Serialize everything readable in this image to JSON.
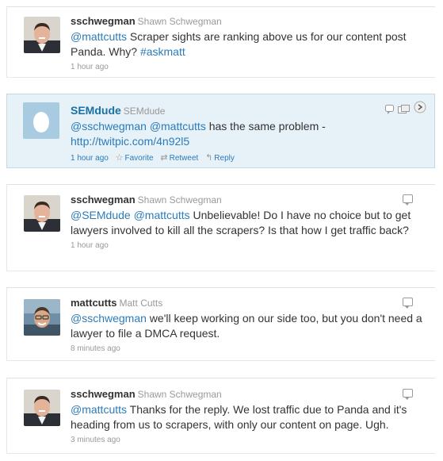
{
  "tweets": [
    {
      "screen_name": "sschwegman",
      "full_name": "Shawn Schwegman",
      "text_segments": [
        {
          "text": "@mattcutts",
          "link": true
        },
        {
          "text": " Scraper sights are ranking above us for our content post Panda. Why? ",
          "link": false
        },
        {
          "text": "#askmatt",
          "link": true
        }
      ],
      "time": "1 hour ago"
    },
    {
      "screen_name": "SEMdude",
      "full_name": "SEMdude",
      "text_segments": [
        {
          "text": "@sschwegman",
          "link": true
        },
        {
          "text": " ",
          "link": false
        },
        {
          "text": "@mattcutts",
          "link": true
        },
        {
          "text": " has the same problem - ",
          "link": false
        },
        {
          "text": "http://twitpic.com/4n92l5",
          "link": true
        }
      ],
      "time": "1 hour ago",
      "actions": {
        "favorite": "Favorite",
        "retweet": "Retweet",
        "reply": "Reply"
      }
    },
    {
      "screen_name": "sschwegman",
      "full_name": "Shawn Schwegman",
      "text_segments": [
        {
          "text": "@SEMdude",
          "link": true
        },
        {
          "text": " ",
          "link": false
        },
        {
          "text": "@mattcutts",
          "link": true
        },
        {
          "text": " Unbelievable! Do I have no choice but to get lawyers involved to kill all the scrapers? Is that how I get traffic back?",
          "link": false
        }
      ],
      "time": "1 hour ago"
    },
    {
      "screen_name": "mattcutts",
      "full_name": "Matt Cutts",
      "text_segments": [
        {
          "text": "@sschwegman",
          "link": true
        },
        {
          "text": " we'll keep working on our side too, but you don't need a lawyer to file a DMCA request.",
          "link": false
        }
      ],
      "time": "8 minutes ago"
    },
    {
      "screen_name": "sschwegman",
      "full_name": "Shawn Schwegman",
      "text_segments": [
        {
          "text": "@mattcutts",
          "link": true
        },
        {
          "text": " Thanks for the reply. We lost traffic due to Panda and it's heading from us to scrapers, with only our content on page. Ugh.",
          "link": false
        }
      ],
      "time": "3 minutes ago"
    }
  ],
  "colors": {
    "link": "#2b7bb9",
    "highlight_bg": "#e6f1f8",
    "meta": "#999999"
  },
  "icons": [
    "reply-icon",
    "favorite-star-icon",
    "retweet-icon",
    "reply-arrow-icon",
    "more-icon",
    "egg-avatar-icon"
  ]
}
